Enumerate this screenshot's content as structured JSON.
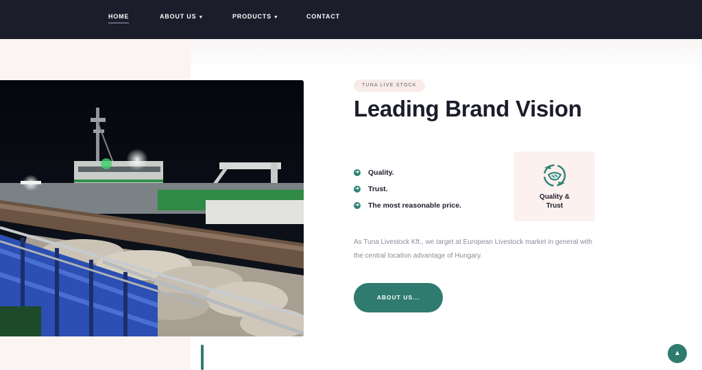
{
  "nav": {
    "items": [
      {
        "label": "HOME",
        "active": true
      },
      {
        "label": "ABOUT US",
        "dropdown": true
      },
      {
        "label": "PRODUCTS",
        "dropdown": true
      },
      {
        "label": "CONTACT"
      }
    ],
    "caret_icon": "chevron-down-icon"
  },
  "hero": {
    "image_subject": "livestock-ship-photo"
  },
  "section": {
    "tag": "TUNA LİVE STOCK",
    "title": "Leading Brand Vision",
    "features": [
      {
        "label": "Quality.",
        "icon": "arrow-circle-right-icon"
      },
      {
        "label": "Trust.",
        "icon": "arrow-circle-right-icon"
      },
      {
        "label": "The most reasonable price.",
        "icon": "arrow-circle-right-icon"
      }
    ],
    "card": {
      "label": "Quality & Trust",
      "icon": "handshake-cycle-icon"
    },
    "description": "As Tuna Livestock Kft., we target at European Livestock market in general with the central location advantage of Hungary.",
    "button_label": "ABOUT US..."
  },
  "scroll_top": {
    "icon": "chevron-up-icon"
  },
  "colors": {
    "nav_bg": "#1c1d2b",
    "accent": "#2f7b70",
    "pink": "#fcf4f2"
  }
}
